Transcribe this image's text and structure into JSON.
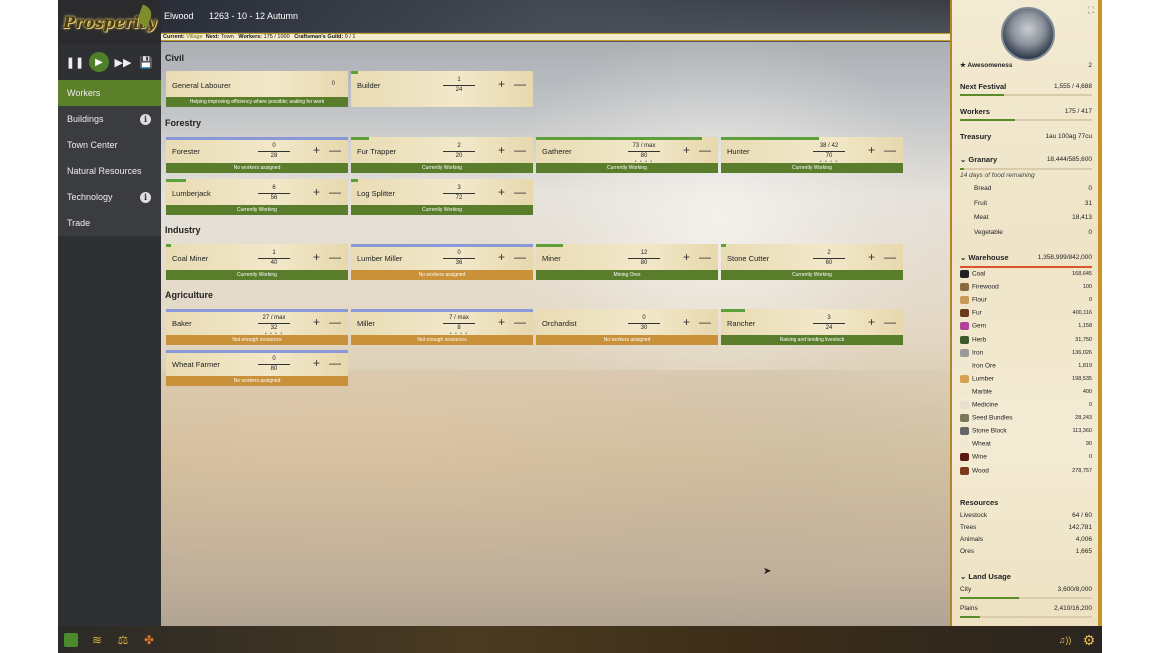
{
  "app": {
    "logo_text": "Prosperity"
  },
  "header": {
    "town": "Elwood",
    "date": "1263 - 10 - 12  Autumn"
  },
  "status": {
    "current_label": "Current:",
    "current": "Village",
    "next_label": "Next:",
    "next": "Town",
    "workers_label": "Workers:",
    "workers": "175 / 1000",
    "guild_label": "Craftsman's Guild:",
    "guild": "0 / 1"
  },
  "controls": {
    "pause": "❚❚",
    "play": "▶",
    "fast": "▶▶",
    "save": "💾"
  },
  "sidebar": {
    "items": [
      {
        "label": "Workers",
        "active": true,
        "info": false
      },
      {
        "label": "Buildings",
        "active": false,
        "info": true
      },
      {
        "label": "Town Center",
        "active": false,
        "info": false
      },
      {
        "label": "Natural Resources",
        "active": false,
        "info": false
      },
      {
        "label": "Technology",
        "active": false,
        "info": true
      },
      {
        "label": "Trade",
        "active": false,
        "info": false
      }
    ],
    "info_glyph": "i"
  },
  "sections": {
    "civil": "Civil",
    "forestry": "Forestry",
    "industry": "Industry",
    "agriculture": "Agriculture"
  },
  "cards": [
    {
      "name": "General Labourer",
      "single": "0",
      "status": "Helping improving efficiency where possible; waiting for work",
      "status_color": "green",
      "bar_color": "",
      "bar_fill": 0,
      "buttons": false
    },
    {
      "name": "Builder",
      "top": "1",
      "bottom": "24",
      "status": "",
      "bar_color": "#5da03a",
      "bar_fill": 0.04,
      "buttons": true
    },
    {
      "name": "Forester",
      "top": "0",
      "bottom": "28",
      "status": "No workers assigned",
      "status_color": "green",
      "bar_color": "#8a98d8",
      "bar_fill": 1,
      "buttons": true
    },
    {
      "name": "Fur Trapper",
      "top": "2",
      "bottom": "20",
      "status": "Currently Working",
      "status_color": "green",
      "bar_color": "#5da03a",
      "bar_fill": 0.1,
      "buttons": true
    },
    {
      "name": "Gatherer",
      "top": "73 / max",
      "bottom": "80",
      "dots": true,
      "status": "Currently Working",
      "status_color": "green",
      "bar_color": "#5da03a",
      "bar_fill": 0.91,
      "buttons": true
    },
    {
      "name": "Hunter",
      "top": "38 / 42",
      "bottom": "70",
      "dots": true,
      "status": "Currently Working",
      "status_color": "green",
      "bar_color": "#5da03a",
      "bar_fill": 0.54,
      "buttons": true
    },
    {
      "name": "Lumberjack",
      "top": "6",
      "bottom": "56",
      "status": "Currently Working",
      "status_color": "green",
      "bar_color": "#5da03a",
      "bar_fill": 0.11,
      "buttons": true
    },
    {
      "name": "Log Splitter",
      "top": "3",
      "bottom": "72",
      "status": "Currently Working",
      "status_color": "green",
      "bar_color": "#5da03a",
      "bar_fill": 0.04,
      "buttons": true
    },
    {
      "name": "Coal Miner",
      "top": "1",
      "bottom": "40",
      "status": "Currently Working",
      "status_color": "green",
      "bar_color": "#5da03a",
      "bar_fill": 0.03,
      "buttons": true
    },
    {
      "name": "Lumber Miller",
      "top": "0",
      "bottom": "36",
      "status": "No workers assigned",
      "status_color": "orange",
      "bar_color": "#8a98d8",
      "bar_fill": 1,
      "buttons": true
    },
    {
      "name": "Miner",
      "top": "12",
      "bottom": "80",
      "status": "Mining Ores",
      "status_color": "green",
      "bar_color": "#5da03a",
      "bar_fill": 0.15,
      "buttons": true
    },
    {
      "name": "Stone Cutter",
      "top": "2",
      "bottom": "60",
      "status": "Currently Working",
      "status_color": "green",
      "bar_color": "#5da03a",
      "bar_fill": 0.03,
      "buttons": true
    },
    {
      "name": "Baker",
      "top": "27 / max",
      "bottom": "32",
      "dots": true,
      "status": "Not enough resources",
      "status_color": "orange",
      "bar_color": "#8a98d8",
      "bar_fill": 1,
      "buttons": true
    },
    {
      "name": "Miller",
      "top": "7 / max",
      "bottom": "8",
      "dots": true,
      "status": "Not enough resources",
      "status_color": "orange",
      "bar_color": "#8a98d8",
      "bar_fill": 1,
      "buttons": true
    },
    {
      "name": "Orchardist",
      "top": "0",
      "bottom": "30",
      "status": "No workers assigned",
      "status_color": "orange",
      "bar_color": "",
      "bar_fill": 0,
      "buttons": true
    },
    {
      "name": "Rancher",
      "top": "3",
      "bottom": "24",
      "status": "Raising and tending livestock",
      "status_color": "green",
      "bar_color": "#5da03a",
      "bar_fill": 0.13,
      "buttons": true
    },
    {
      "name": "Wheat Farmer",
      "top": "0",
      "bottom": "80",
      "status": "No workers assigned",
      "status_color": "orange",
      "bar_color": "#8a98d8",
      "bar_fill": 1,
      "buttons": true
    }
  ],
  "card_buttons": {
    "plus": "+",
    "minus": "—"
  },
  "right": {
    "expand_glyph": "⛶",
    "awesomeness_label": "★ Awesomeness",
    "awesomeness": "2",
    "festival_label": "Next Festival",
    "festival": "1,555 / 4,688",
    "festival_fill": 0.33,
    "workers_label": "Workers",
    "workers": "175 / 417",
    "workers_fill": 0.42,
    "treasury_label": "Treasury",
    "treasury": "1au 100ag 77cu",
    "granary_label": "Granary",
    "granary": "18,444/585,600",
    "granary_note": "14 days of food remaining",
    "food": [
      {
        "name": "Bread",
        "value": "0"
      },
      {
        "name": "Fruit",
        "value": "31"
      },
      {
        "name": "Meat",
        "value": "18,413"
      },
      {
        "name": "Vegetable",
        "value": "0"
      }
    ],
    "warehouse_label": "Warehouse",
    "warehouse": "1,358,999/842,000",
    "goods": [
      {
        "name": "Coal",
        "value": "168,645",
        "color": "#222"
      },
      {
        "name": "Firewood",
        "value": "100",
        "color": "#8a6a3a"
      },
      {
        "name": "Flour",
        "value": "0",
        "color": "#c89a55"
      },
      {
        "name": "Fur",
        "value": "400,116",
        "color": "#6a3a1a"
      },
      {
        "name": "Gem",
        "value": "1,158",
        "color": "#b0409a"
      },
      {
        "name": "Herb",
        "value": "31,750",
        "color": "#3f5a2a"
      },
      {
        "name": "Iron",
        "value": "136,026",
        "color": "#9a9a9a"
      },
      {
        "name": "Iron Ore",
        "value": "1,819",
        "color": "#f0e8d0"
      },
      {
        "name": "Lumber",
        "value": "198,535",
        "color": "#d6a050"
      },
      {
        "name": "Marble",
        "value": "400",
        "color": "#f0e8d0"
      },
      {
        "name": "Medicine",
        "value": "0",
        "color": "#e8e0d0"
      },
      {
        "name": "Seed Bundles",
        "value": "28,243",
        "color": "#7a7a5a"
      },
      {
        "name": "Stone Block",
        "value": "113,360",
        "color": "#666"
      },
      {
        "name": "Wheat",
        "value": "90",
        "color": "#f0e8d0"
      },
      {
        "name": "Wine",
        "value": "0",
        "color": "#5a1a10"
      },
      {
        "name": "Wood",
        "value": "278,757",
        "color": "#7a3a1a"
      }
    ],
    "resources_label": "Resources",
    "resources": [
      {
        "name": "Livestock",
        "value": "64 / 60"
      },
      {
        "name": "Trees",
        "value": "142,781"
      },
      {
        "name": "Animals",
        "value": "4,006"
      },
      {
        "name": "Ores",
        "value": "1,665"
      }
    ],
    "land_label": "Land Usage",
    "land": [
      {
        "name": "City",
        "value": "3,600/8,000",
        "fill": 0.45
      },
      {
        "name": "Plains",
        "value": "2,410/16,200",
        "fill": 0.15
      }
    ],
    "chevron": "⌄"
  },
  "bottom": {
    "icons": [
      "book-icon",
      "scroll-icon",
      "scales-icon",
      "dice-icon",
      "music-icon",
      "settings-icon"
    ],
    "music_glyph": "♫))",
    "settings_glyph": "⚙"
  }
}
